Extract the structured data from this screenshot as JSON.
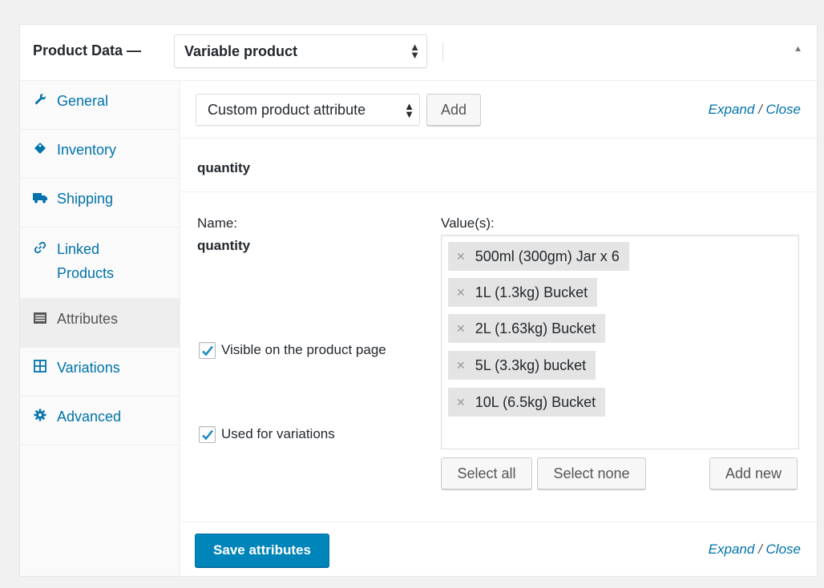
{
  "header": {
    "title": "Product Data —",
    "product_type": "Variable product"
  },
  "sidebar": {
    "items": [
      {
        "label": "General",
        "icon": "wrench-icon"
      },
      {
        "label": "Inventory",
        "icon": "tag-icon"
      },
      {
        "label": "Shipping",
        "icon": "truck-icon"
      },
      {
        "label": "Linked Products",
        "icon": "link-icon"
      },
      {
        "label": "Attributes",
        "icon": "list-icon",
        "active": true
      },
      {
        "label": "Variations",
        "icon": "grid-icon"
      },
      {
        "label": "Advanced",
        "icon": "gear-icon"
      }
    ]
  },
  "toolbar": {
    "attribute_select": "Custom product attribute",
    "add_label": "Add",
    "expand_label": "Expand",
    "close_label": "Close",
    "separator": "/"
  },
  "attribute": {
    "heading": "quantity",
    "name_label": "Name:",
    "name_value": "quantity",
    "values_label": "Value(s):",
    "values": [
      "500ml (300gm) Jar x 6",
      "1L (1.3kg) Bucket",
      "2L (1.63kg) Bucket",
      "5L (3.3kg) bucket",
      "10L (6.5kg) Bucket"
    ],
    "visible_label": "Visible on the product page",
    "visible_checked": true,
    "variations_label": "Used for variations",
    "variations_checked": true,
    "select_all_label": "Select all",
    "select_none_label": "Select none",
    "add_new_label": "Add new"
  },
  "footer": {
    "save_label": "Save attributes",
    "expand_label": "Expand",
    "close_label": "Close",
    "separator": "/"
  },
  "colors": {
    "link": "#0073aa",
    "primary_button": "#0085ba",
    "chip_bg": "#e4e4e4"
  }
}
